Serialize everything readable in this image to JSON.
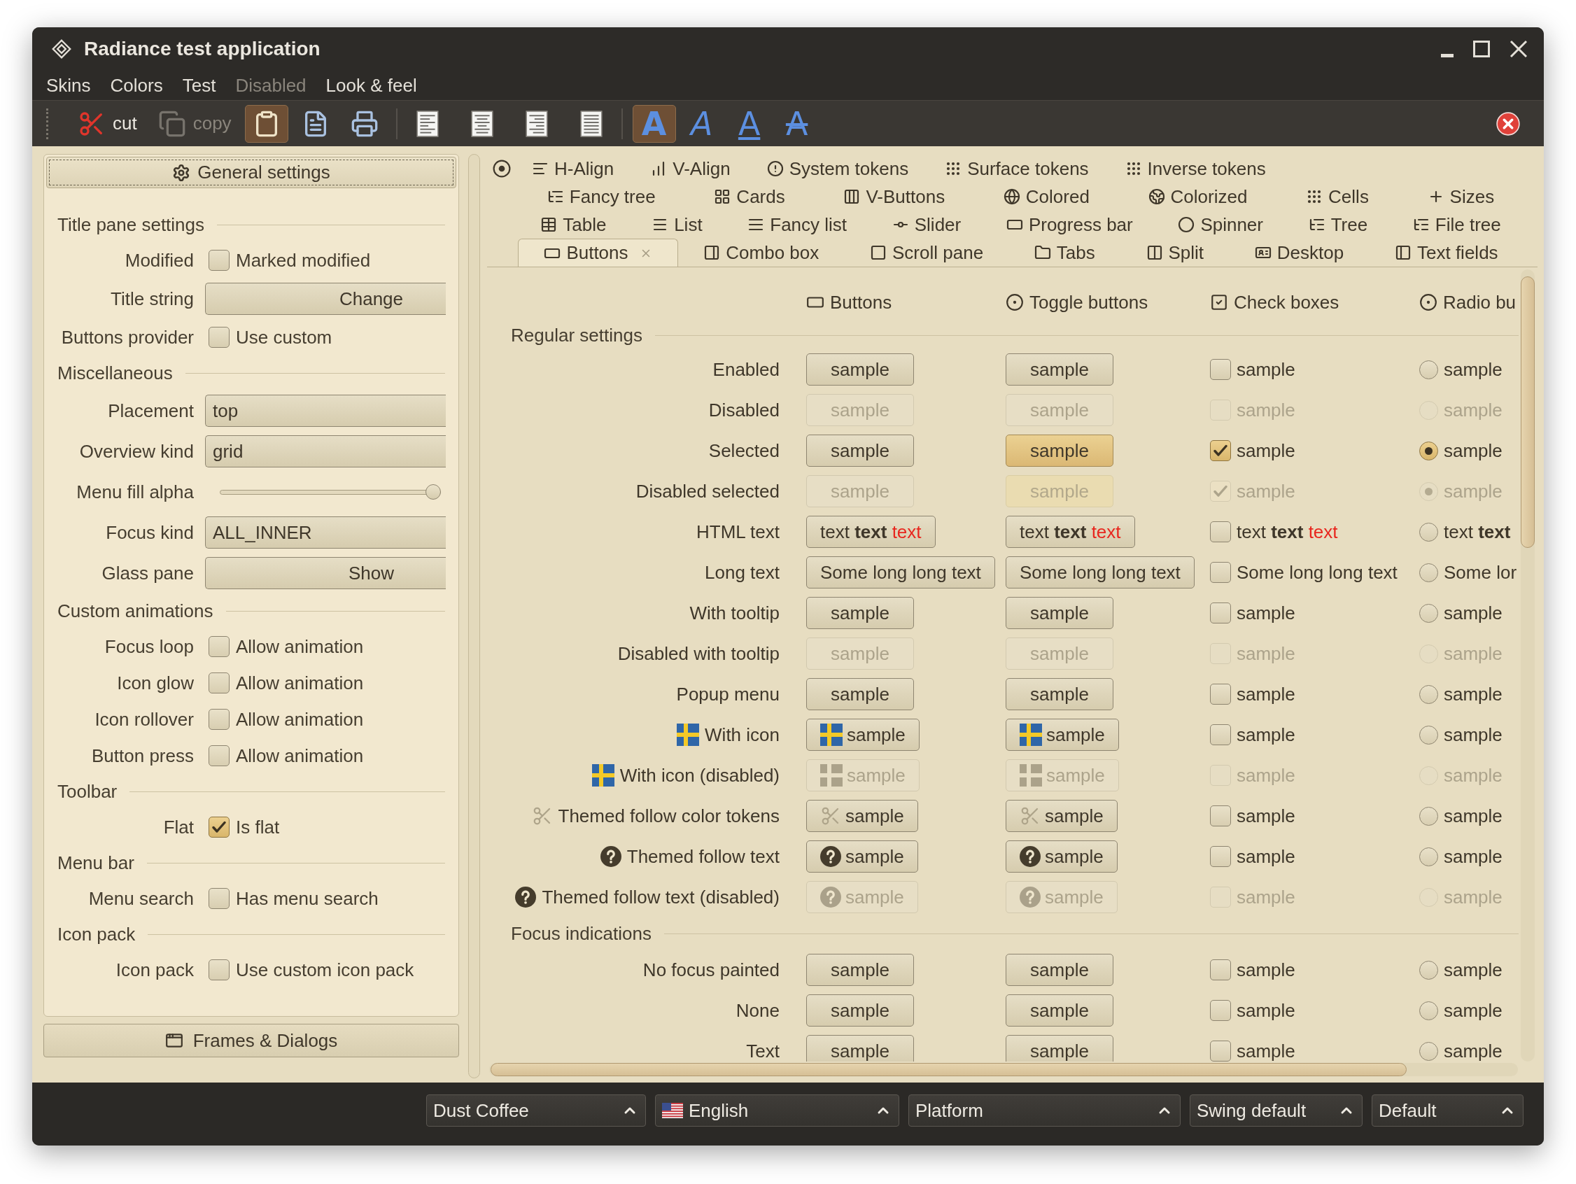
{
  "window": {
    "title": "Radiance test application"
  },
  "menu": [
    {
      "label": "Skins",
      "disabled": false
    },
    {
      "label": "Colors",
      "disabled": false
    },
    {
      "label": "Test",
      "disabled": false
    },
    {
      "label": "Disabled",
      "disabled": true
    },
    {
      "label": "Look & feel",
      "disabled": false
    }
  ],
  "toolbar": {
    "groups": [
      {
        "buttons": [
          {
            "label": "cut",
            "selected": false,
            "disabled": false
          },
          {
            "label": "copy",
            "selected": false,
            "disabled": true
          },
          {
            "selected": true,
            "disabled": false
          },
          {
            "selected": false,
            "disabled": false
          },
          {
            "selected": false,
            "disabled": false
          }
        ]
      },
      {
        "buttons": [
          {
            "selected": false,
            "disabled": false
          },
          {
            "selected": false,
            "disabled": false
          },
          {
            "selected": false,
            "disabled": false
          },
          {
            "selected": false,
            "disabled": false
          }
        ]
      },
      {
        "buttons": [
          {
            "glyph": "A",
            "kind": "bold",
            "selected": true,
            "disabled": false
          },
          {
            "glyph": "A",
            "kind": "italic",
            "selected": false,
            "disabled": false
          },
          {
            "glyph": "A",
            "kind": "underline",
            "selected": false,
            "disabled": false
          },
          {
            "glyph": "A",
            "kind": "strike",
            "selected": false,
            "disabled": false
          }
        ]
      }
    ]
  },
  "settings_panel": {
    "header": "General settings",
    "sections": [
      {
        "title": "Title pane settings",
        "rows": [
          {
            "label": "Modified",
            "kind": "checkbox",
            "text": "Marked modified",
            "checked": false
          },
          {
            "label": "Title string",
            "kind": "button",
            "text": "Change"
          },
          {
            "label": "Buttons provider",
            "kind": "checkbox",
            "text": "Use custom",
            "checked": false
          }
        ]
      },
      {
        "title": "Miscellaneous",
        "rows": [
          {
            "label": "Placement",
            "kind": "combo",
            "value": "top"
          },
          {
            "label": "Overview kind",
            "kind": "combo",
            "value": "grid"
          },
          {
            "label": "Menu fill alpha",
            "kind": "slider",
            "level": 1
          },
          {
            "label": "Focus kind",
            "kind": "combo",
            "value": "ALL_INNER"
          },
          {
            "label": "Glass pane",
            "kind": "button",
            "text": "Show"
          }
        ]
      },
      {
        "title": "Custom animations",
        "rows": [
          {
            "label": "Focus loop",
            "kind": "checkbox",
            "text": "Allow animation",
            "checked": false
          },
          {
            "label": "Icon glow",
            "kind": "checkbox",
            "text": "Allow animation",
            "checked": false
          },
          {
            "label": "Icon rollover",
            "kind": "checkbox",
            "text": "Allow animation",
            "checked": false
          },
          {
            "label": "Button press",
            "kind": "checkbox",
            "text": "Allow animation",
            "checked": false
          }
        ]
      },
      {
        "title": "Toolbar",
        "rows": [
          {
            "label": "Flat",
            "kind": "checkbox",
            "text": "Is flat",
            "checked": true
          }
        ]
      },
      {
        "title": "Menu bar",
        "rows": [
          {
            "label": "Menu search",
            "kind": "checkbox",
            "text": "Has menu search",
            "checked": false
          }
        ]
      },
      {
        "title": "Icon pack",
        "rows": [
          {
            "label": "Icon pack",
            "kind": "checkbox",
            "text": "Use custom icon pack",
            "checked": false
          }
        ]
      }
    ],
    "footer": "Frames & Dialogs"
  },
  "tabs": {
    "rows": [
      {
        "tabs": [
          {
            "label": "H-Align",
            "selected": false
          },
          {
            "label": "V-Align",
            "selected": false
          },
          {
            "label": "System tokens",
            "selected": false
          },
          {
            "label": "Surface tokens",
            "selected": false
          },
          {
            "label": "Inverse tokens",
            "selected": false
          }
        ]
      },
      {
        "tabs": [
          {
            "label": "Fancy tree",
            "selected": false
          },
          {
            "label": "Cards",
            "selected": false
          },
          {
            "label": "V-Buttons",
            "selected": false
          },
          {
            "label": "Colored",
            "selected": false
          },
          {
            "label": "Colorized",
            "selected": false
          },
          {
            "label": "Cells",
            "selected": false
          },
          {
            "label": "Sizes",
            "selected": false
          }
        ]
      },
      {
        "tabs": [
          {
            "label": "Table",
            "selected": false
          },
          {
            "label": "List",
            "selected": false
          },
          {
            "label": "Fancy list",
            "selected": false
          },
          {
            "label": "Slider",
            "selected": false
          },
          {
            "label": "Progress bar",
            "selected": false
          },
          {
            "label": "Spinner",
            "selected": false
          },
          {
            "label": "Tree",
            "selected": false
          },
          {
            "label": "File tree",
            "selected": false
          }
        ]
      },
      {
        "tabs": [
          {
            "label": "Buttons",
            "selected": true
          },
          {
            "label": "Combo box",
            "selected": false
          },
          {
            "label": "Scroll pane",
            "selected": false
          },
          {
            "label": "Tabs",
            "selected": false
          },
          {
            "label": "Split",
            "selected": false
          },
          {
            "label": "Desktop",
            "selected": false
          },
          {
            "label": "Text fields",
            "selected": false
          }
        ]
      }
    ]
  },
  "content": {
    "headers": [
      {
        "label": "Buttons"
      },
      {
        "label": "Toggle buttons"
      },
      {
        "label": "Check boxes"
      },
      {
        "label": "Radio bu"
      }
    ],
    "sections": [
      {
        "title": "Regular settings",
        "rows": [
          {
            "label": "Enabled",
            "kind": "plain",
            "disabled": false,
            "controls": [
              {
                "text": "sample"
              },
              {
                "text": "sample",
                "selected": false
              },
              {
                "text": "sample",
                "checked": false
              },
              {
                "text": "sample",
                "selected": false
              }
            ]
          },
          {
            "label": "Disabled",
            "kind": "plain",
            "disabled": true,
            "controls": [
              {
                "text": "sample"
              },
              {
                "text": "sample",
                "selected": false
              },
              {
                "text": "sample",
                "checked": false
              },
              {
                "text": "sample",
                "selected": false
              }
            ]
          },
          {
            "label": "Selected",
            "kind": "plain",
            "disabled": false,
            "controls": [
              {
                "text": "sample"
              },
              {
                "text": "sample",
                "selected": true
              },
              {
                "text": "sample",
                "checked": true
              },
              {
                "text": "sample",
                "selected": true
              }
            ]
          },
          {
            "label": "Disabled selected",
            "kind": "plain",
            "disabled": true,
            "controls": [
              {
                "text": "sample"
              },
              {
                "text": "sample",
                "selected": true
              },
              {
                "text": "sample",
                "checked": true
              },
              {
                "text": "sample",
                "selected": true
              }
            ]
          },
          {
            "label": "HTML text",
            "kind": "plain",
            "disabled": false,
            "controls": [
              {
                "parts": [
                  {
                    "text": "text",
                    "bold": false
                  },
                  {
                    "text": "text",
                    "bold": true
                  },
                  {
                    "text": "text",
                    "bold": false,
                    "color": "#e8271f"
                  }
                ]
              },
              {
                "parts": [
                  {
                    "text": "text",
                    "bold": false
                  },
                  {
                    "text": "text",
                    "bold": true
                  },
                  {
                    "text": "text",
                    "bold": false,
                    "color": "#e8271f"
                  }
                ],
                "selected": false
              },
              {
                "parts": [
                  {
                    "text": "text",
                    "bold": false
                  },
                  {
                    "text": "text",
                    "bold": true
                  },
                  {
                    "text": "text",
                    "bold": false,
                    "color": "#e8271f"
                  }
                ],
                "checked": false
              },
              {
                "parts": [
                  {
                    "text": "text",
                    "bold": false
                  },
                  {
                    "text": "text",
                    "bold": true
                  }
                ],
                "selected": false
              }
            ]
          },
          {
            "label": "Long text",
            "kind": "plain",
            "disabled": false,
            "controls": [
              {
                "text": "Some long long text"
              },
              {
                "text": "Some long long text",
                "selected": false
              },
              {
                "text": "Some long long text",
                "checked": false
              },
              {
                "text": "Some lor",
                "selected": false
              }
            ]
          },
          {
            "label": "With tooltip",
            "kind": "plain",
            "disabled": false,
            "controls": [
              {
                "text": "sample"
              },
              {
                "text": "sample",
                "selected": false
              },
              {
                "text": "sample",
                "checked": false
              },
              {
                "text": "sample",
                "selected": false
              }
            ]
          },
          {
            "label": "Disabled with tooltip",
            "kind": "plain",
            "disabled": true,
            "controls": [
              {
                "text": "sample"
              },
              {
                "text": "sample",
                "selected": false
              },
              {
                "text": "sample",
                "checked": false
              },
              {
                "text": "sample",
                "selected": false
              }
            ]
          },
          {
            "label": "Popup menu",
            "kind": "plain",
            "disabled": false,
            "controls": [
              {
                "text": "sample"
              },
              {
                "text": "sample",
                "selected": false
              },
              {
                "text": "sample",
                "checked": false
              },
              {
                "text": "sample",
                "selected": false
              }
            ]
          },
          {
            "label": "With icon",
            "kind": "flag",
            "disabled": false,
            "controls": [
              {
                "text": "sample"
              },
              {
                "text": "sample",
                "selected": false
              },
              {
                "text": "sample",
                "checked": false
              },
              {
                "text": "sample",
                "selected": false
              }
            ]
          },
          {
            "label": "With icon (disabled)",
            "kind": "flag",
            "disabled": true,
            "controls": [
              {
                "text": "sample"
              },
              {
                "text": "sample",
                "selected": false
              },
              {
                "text": "sample",
                "checked": false
              },
              {
                "text": "sample",
                "selected": false
              }
            ]
          },
          {
            "label": "Themed follow color tokens",
            "kind": "scissors",
            "disabled": false,
            "controls": [
              {
                "text": "sample"
              },
              {
                "text": "sample",
                "selected": false
              },
              {
                "text": "sample",
                "checked": false
              },
              {
                "text": "sample",
                "selected": false
              }
            ]
          },
          {
            "label": "Themed follow text",
            "kind": "help",
            "disabled": false,
            "controls": [
              {
                "text": "sample"
              },
              {
                "text": "sample",
                "selected": false
              },
              {
                "text": "sample",
                "checked": false
              },
              {
                "text": "sample",
                "selected": false
              }
            ]
          },
          {
            "label": "Themed follow text (disabled)",
            "kind": "help",
            "disabled": true,
            "controls": [
              {
                "text": "sample"
              },
              {
                "text": "sample",
                "selected": false
              },
              {
                "text": "sample",
                "checked": false
              },
              {
                "text": "sample",
                "selected": false
              }
            ]
          }
        ]
      },
      {
        "title": "Focus indications",
        "rows": [
          {
            "label": "No focus painted",
            "kind": "plain",
            "disabled": false,
            "controls": [
              {
                "text": "sample"
              },
              {
                "text": "sample",
                "selected": false
              },
              {
                "text": "sample",
                "checked": false
              },
              {
                "text": "sample",
                "selected": false
              }
            ]
          },
          {
            "label": "None",
            "kind": "plain",
            "disabled": false,
            "controls": [
              {
                "text": "sample"
              },
              {
                "text": "sample",
                "selected": false
              },
              {
                "text": "sample",
                "checked": false
              },
              {
                "text": "sample",
                "selected": false
              }
            ]
          },
          {
            "label": "Text",
            "kind": "plain",
            "disabled": false,
            "controls": [
              {
                "text": "sample"
              },
              {
                "text": "sample",
                "selected": false
              },
              {
                "text": "sample",
                "checked": false
              },
              {
                "text": "sample",
                "selected": false
              }
            ]
          }
        ]
      }
    ]
  },
  "status_bar": {
    "combos": [
      {
        "value": "Dust Coffee",
        "kind": "plain"
      },
      {
        "value": "English",
        "kind": "flag"
      },
      {
        "value": "Platform",
        "kind": "plain"
      },
      {
        "value": "Swing default",
        "kind": "plain"
      },
      {
        "value": "Default",
        "kind": "plain"
      }
    ]
  }
}
